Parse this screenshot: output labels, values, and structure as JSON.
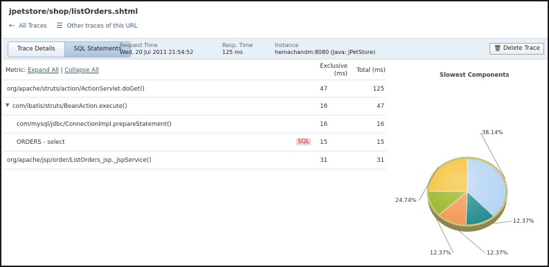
{
  "header": {
    "title": "jpetstore/shop/listOrders.shtml",
    "all_traces": "All Traces",
    "other_traces": "Other traces of this URL"
  },
  "tabs": [
    {
      "label": "Trace Details",
      "active": false
    },
    {
      "label": "SQL Statements",
      "active": true
    }
  ],
  "meta": {
    "request_time_label": "Request Time",
    "request_time": "Wed, 20 Jul 2011 21:54:52",
    "resp_time_label": "Resp. Time",
    "resp_time": "125 ms",
    "instance_label": "Instance",
    "instance": "hemachandm:8080 (Java: JPetStore)"
  },
  "delete_trace": "Delete Trace",
  "metric": {
    "label": "Metric:",
    "expand_all": "Expand All",
    "separator": "|",
    "collapse_all": "Collapse All"
  },
  "columns": {
    "exclusive_line1": "Exclusive",
    "exclusive_line2": "(ms)",
    "total": "Total (ms)"
  },
  "rows": [
    {
      "name": "org/apache/struts/action/ActionServlet.doGet()",
      "exclusive": "47",
      "total": "125",
      "indent": 0,
      "toggle": "",
      "badge": ""
    },
    {
      "name": "com/ibatis/struts/BeanAction.execute()",
      "exclusive": "16",
      "total": "47",
      "indent": 0,
      "toggle": "▼",
      "badge": ""
    },
    {
      "name": "com/mysql/jdbc/ConnectionImpl.prepareStatement()",
      "exclusive": "16",
      "total": "16",
      "indent": 1,
      "toggle": "",
      "badge": ""
    },
    {
      "name": "ORDERS - select",
      "exclusive": "15",
      "total": "15",
      "indent": 1,
      "toggle": "",
      "badge": "SQL"
    },
    {
      "name": "org/apache/jsp/order/ListOrders_jsp._jspService()",
      "exclusive": "31",
      "total": "31",
      "indent": 0,
      "toggle": "",
      "badge": ""
    }
  ],
  "chart_data": {
    "type": "pie",
    "title": "Slowest Components",
    "series": [
      {
        "value": 38.14,
        "label": "38.14%",
        "color": "#b3d3f4"
      },
      {
        "value": 12.37,
        "label": "12.37%",
        "color": "#1e8b8b"
      },
      {
        "value": 12.37,
        "label": "12.37%",
        "color": "#f4944f"
      },
      {
        "value": 12.37,
        "label": "12.37%",
        "color": "#93b41c"
      },
      {
        "value": 24.74,
        "label": "24.74%",
        "color": "#f4be2a"
      }
    ]
  }
}
